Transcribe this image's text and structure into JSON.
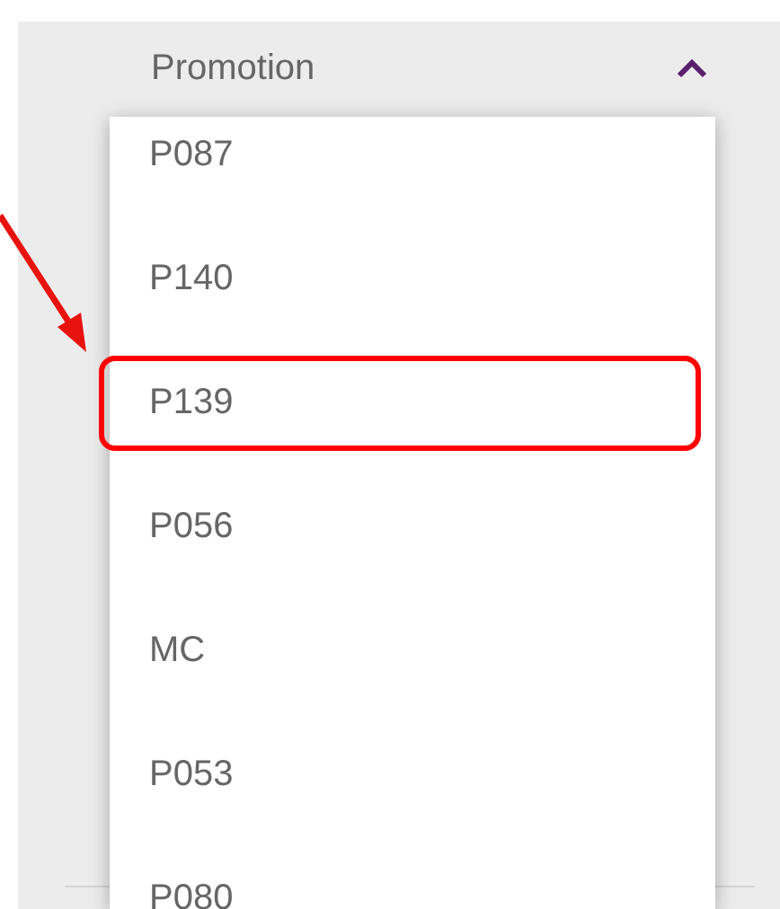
{
  "filter": {
    "label": "Promotion",
    "expanded": true
  },
  "options": [
    {
      "label": "P087",
      "highlighted": false
    },
    {
      "label": "P140",
      "highlighted": false
    },
    {
      "label": "P139",
      "highlighted": true
    },
    {
      "label": "P056",
      "highlighted": false
    },
    {
      "label": "MC",
      "highlighted": false
    },
    {
      "label": "P053",
      "highlighted": false
    },
    {
      "label": "P080",
      "highlighted": false
    }
  ]
}
